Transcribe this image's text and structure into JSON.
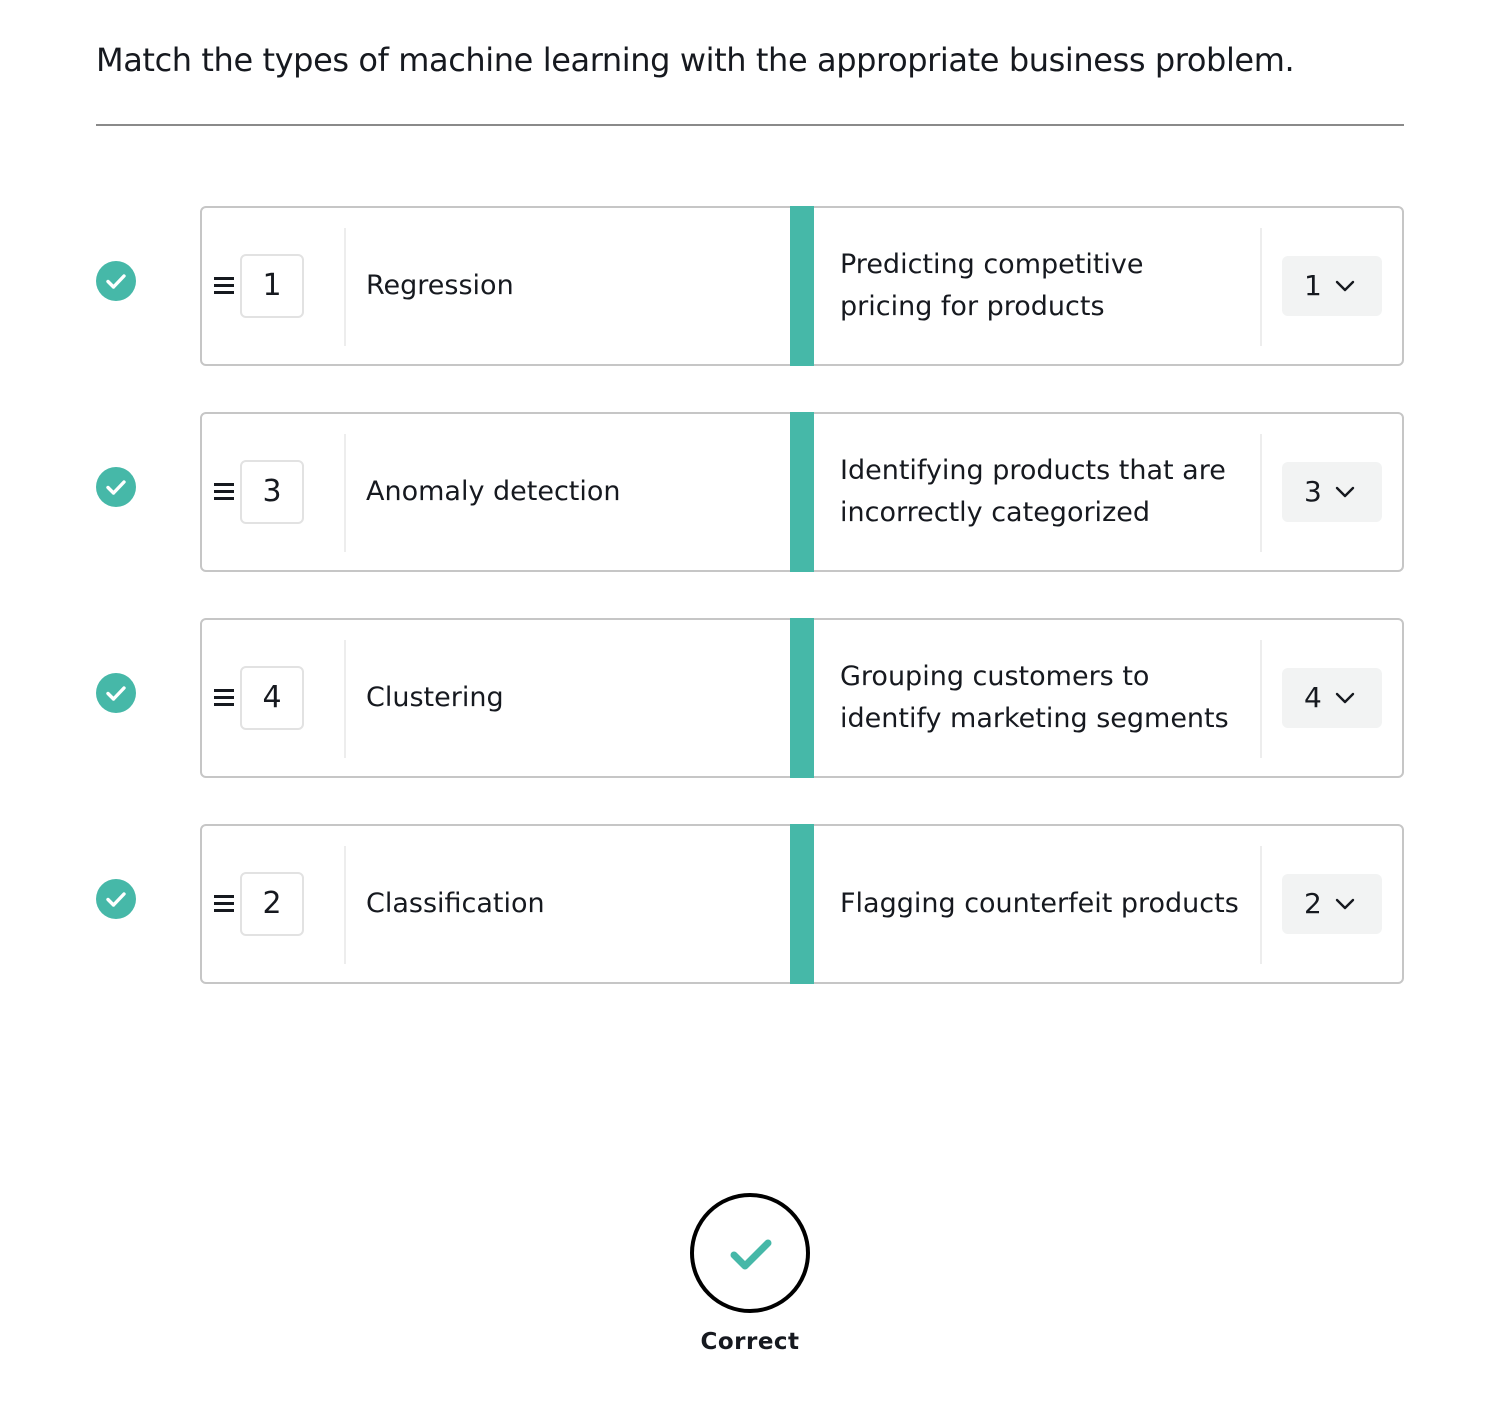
{
  "question": "Match the types of machine learning with the appropriate business problem.",
  "accent_color": "#46b8a8",
  "rows": [
    {
      "status": "correct",
      "status_icon": "check-circle-icon",
      "order": "1",
      "term": "Regression",
      "problem": "Predicting competitive pricing for products",
      "selected": "1"
    },
    {
      "status": "correct",
      "status_icon": "check-circle-icon",
      "order": "3",
      "term": "Anomaly detection",
      "problem": "Identifying products that are incorrectly categorized",
      "selected": "3"
    },
    {
      "status": "correct",
      "status_icon": "check-circle-icon",
      "order": "4",
      "term": "Clustering",
      "problem": "Grouping customers to identify marketing segments",
      "selected": "4"
    },
    {
      "status": "correct",
      "status_icon": "check-circle-icon",
      "order": "2",
      "term": "Classification",
      "problem": "Flagging counterfeit products",
      "selected": "2"
    }
  ],
  "result": {
    "icon": "checkmark-icon",
    "label": "Correct"
  }
}
